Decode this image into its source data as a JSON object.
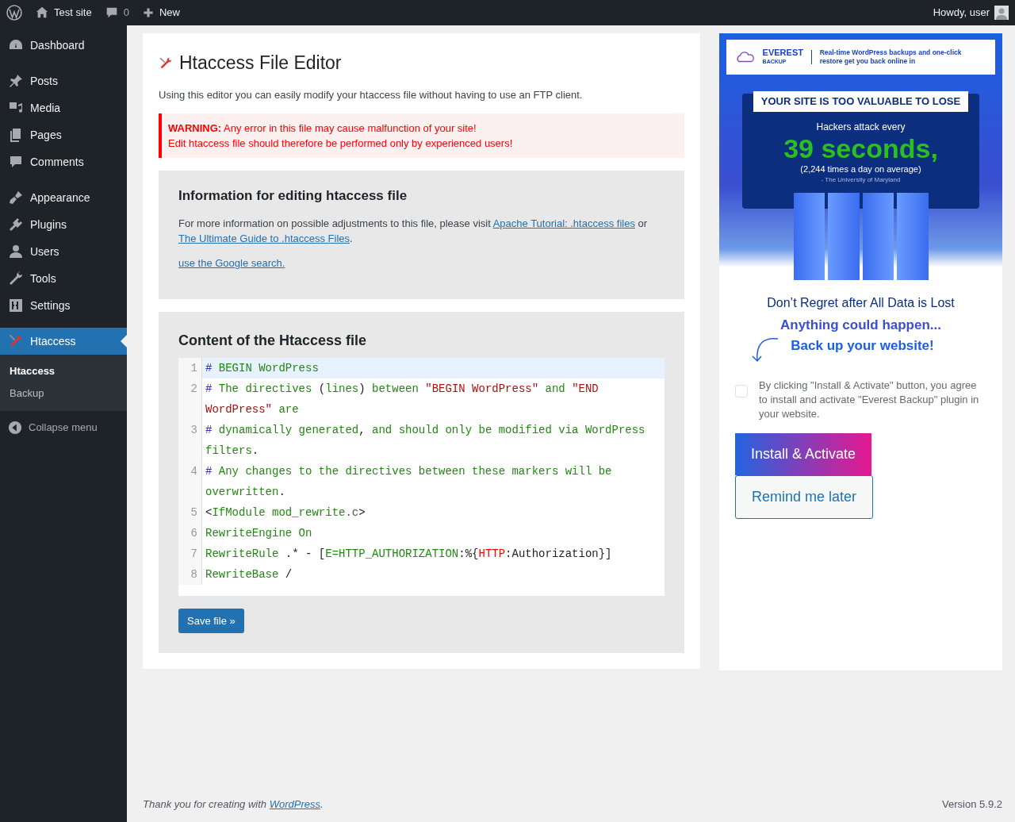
{
  "admin_bar": {
    "site": "Test site",
    "comments": "0",
    "new": "New",
    "greeting": "Howdy, user"
  },
  "sidebar": {
    "groups": [
      {
        "items": [
          {
            "label": "Dashboard",
            "selected": false
          }
        ]
      },
      {
        "items": [
          {
            "label": "Posts",
            "selected": false
          },
          {
            "label": "Media",
            "selected": false
          },
          {
            "label": "Pages",
            "selected": false
          },
          {
            "label": "Comments",
            "selected": false
          }
        ]
      },
      {
        "items": [
          {
            "label": "Appearance",
            "selected": false
          },
          {
            "label": "Plugins",
            "selected": false
          },
          {
            "label": "Users",
            "selected": false
          },
          {
            "label": "Tools",
            "selected": false
          },
          {
            "label": "Settings",
            "selected": false
          }
        ]
      },
      {
        "items": [
          {
            "label": "Htaccess",
            "selected": true,
            "children": [
              {
                "label": "Htaccess",
                "selected": true
              },
              {
                "label": "Backup",
                "selected": false
              }
            ]
          }
        ]
      }
    ],
    "collapse": "Collapse menu"
  },
  "page": {
    "title": "Htaccess File Editor",
    "intro": "Using this editor you can easily modify your htaccess file without having to use an FTP client.",
    "warning": [
      "**WARNING:** Any error in this file may cause malfunction of your site!",
      "Edit htaccess file should therefore be performed only by experienced users!"
    ],
    "info": {
      "heading": "Information for editing htaccess file",
      "text_before": "For more information on possible adjustments to this file, please visit",
      "link1": "Apache Tutorial: .htaccess files",
      "text_or": "or",
      "link2": "The Ultimate Guide to .htaccess Files",
      "text_after": ".",
      "google": "use the Google search."
    },
    "content": {
      "heading": "Content of the Htaccess file",
      "lines": [
        {
          "number": "1",
          "selected": true,
          "segments": [
            {
              "t": "#",
              "kind": "hash"
            },
            {
              "t": " BEGIN WordPress",
              "kind": "word"
            }
          ]
        },
        {
          "number": "2",
          "selected": false,
          "segments": [
            {
              "t": "#",
              "kind": "hash"
            },
            {
              "t": " The directives ",
              "kind": "word"
            },
            {
              "t": "(",
              "kind": "punct"
            },
            {
              "t": "lines",
              "kind": "word"
            },
            {
              "t": ")",
              "kind": "punct"
            },
            {
              "t": " between ",
              "kind": "word"
            },
            {
              "t": "\"BEGIN WordPress\"",
              "kind": "string"
            },
            {
              "t": " and ",
              "kind": "word"
            },
            {
              "t": "\"END WordPress\"",
              "kind": "string"
            },
            {
              "t": " are",
              "kind": "word"
            }
          ]
        },
        {
          "number": "3",
          "selected": false,
          "segments": [
            {
              "t": "#",
              "kind": "hash"
            },
            {
              "t": " dynamically generated",
              "kind": "word"
            },
            {
              "t": ",",
              "kind": "punct"
            },
            {
              "t": " and should only be modified via WordPress filters",
              "kind": "word"
            },
            {
              "t": ".",
              "kind": "punct"
            }
          ]
        },
        {
          "number": "4",
          "selected": false,
          "segments": [
            {
              "t": "#",
              "kind": "hash"
            },
            {
              "t": " Any changes to the directives between these markers will be overwritten",
              "kind": "word"
            },
            {
              "t": ".",
              "kind": "punct"
            }
          ]
        },
        {
          "number": "5",
          "selected": false,
          "segments": [
            {
              "t": "<",
              "kind": "punct"
            },
            {
              "t": "IfModule mod_rewrite",
              "kind": "word"
            },
            {
              "t": ".c",
              "kind": "muted"
            },
            {
              "t": ">",
              "kind": "punct"
            }
          ]
        },
        {
          "number": "6",
          "selected": false,
          "segments": [
            {
              "t": "RewriteEngine On",
              "kind": "word"
            }
          ]
        },
        {
          "number": "7",
          "selected": false,
          "segments": [
            {
              "t": "RewriteRule",
              "kind": "word"
            },
            {
              "t": " .* - [",
              "kind": "punct"
            },
            {
              "t": "E=HTTP_AUTHORIZATION",
              "kind": "word"
            },
            {
              "t": ":%{",
              "kind": "punct"
            },
            {
              "t": "HTTP",
              "kind": "var"
            },
            {
              "t": ":Authorization}]",
              "kind": "punct"
            }
          ]
        },
        {
          "number": "8",
          "selected": false,
          "segments": [
            {
              "t": "RewriteBase",
              "kind": "word"
            },
            {
              "t": " /",
              "kind": "punct"
            }
          ]
        }
      ],
      "save": "Save file »"
    }
  },
  "ad": {
    "brand": "EVEREST",
    "brand_sub": "BACKUP",
    "tagline": "Real-time WordPress backups and one-click restore get you back online in",
    "banner": "YOUR SITE IS TOO VALUABLE TO LOSE",
    "attack": "Hackers attack every",
    "seconds": "39 seconds,",
    "per_day": "(2,244 times a day on average)",
    "source": "- The University of Maryland",
    "regret": "Don’t Regret after All Data is Lost",
    "happen": "Anything could happen...",
    "backup": "Back up your website!",
    "consent": {
      "checked": false,
      "text": "By clicking \"Install & Activate\" button, you agree to install and activate \"Everest Backup\" plugin in your website."
    },
    "install": "Install & Activate",
    "remind": "Remind me later"
  },
  "footer": {
    "thanks": "Thank you for creating with",
    "link": "WordPress",
    "after": ".",
    "version": "Version 5.9.2"
  }
}
